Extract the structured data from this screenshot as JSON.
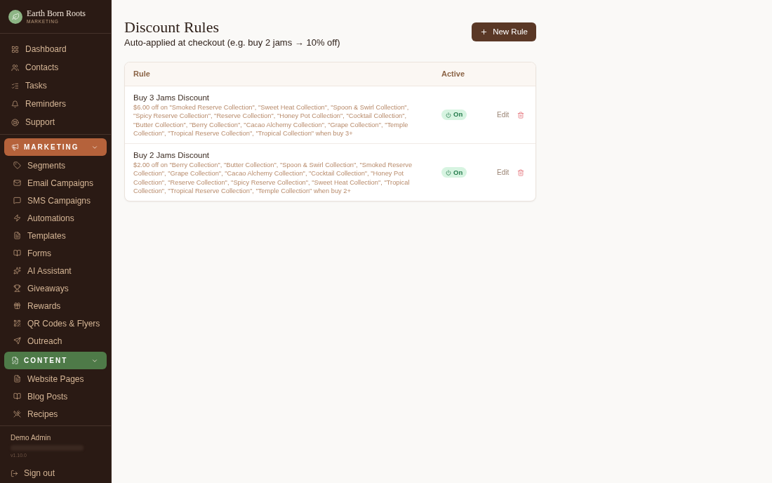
{
  "sidebar": {
    "brand": {
      "name": "Earth Born Roots",
      "subtitle": "MARKETING"
    },
    "items": [
      "Dashboard",
      "Contacts",
      "Tasks",
      "Reminders",
      "Support"
    ],
    "sections": [
      {
        "title": "MARKETING",
        "color": "#b5623b",
        "expanded": true,
        "items": [
          "Segments",
          "Email Campaigns",
          "SMS Campaigns",
          "Automations",
          "Templates",
          "Forms",
          "AI Assistant",
          "Giveaways",
          "Rewards",
          "QR Codes & Flyers",
          "Outreach"
        ]
      },
      {
        "title": "CONTENT",
        "color": "#4e7a48",
        "expanded": true,
        "items": [
          "Website Pages",
          "Blog Posts",
          "Recipes"
        ]
      }
    ],
    "user": {
      "name": "Demo Admin",
      "version": "v1.10.0"
    },
    "sign_out": "Sign out"
  },
  "page": {
    "title": "Discount Rules",
    "subtitle": "Auto-applied at checkout (e.g. buy 2 jams → 10% off)",
    "new_button": "New Rule"
  },
  "table": {
    "columns": [
      "Rule",
      "Active"
    ],
    "rows": [
      {
        "name": "Buy 3 Jams Discount",
        "description": "$6.00 off on \"Smoked Reserve Collection\", \"Sweet Heat Collection\", \"Spoon & Swirl Collection\", \"Spicy Reserve Collection\", \"Reserve Collection\", \"Honey Pot Collection\", \"Cocktail Collection\", \"Butter Collection\", \"Berry Collection\", \"Cacao Alchemy Collection\", \"Grape Collection\", \"Temple Collection\", \"Tropical Reserve Collection\", \"Tropical Collection\" when buy 3+",
        "active": true,
        "status": "On",
        "edit": "Edit"
      },
      {
        "name": "Buy 2 Jams Discount",
        "description": "$2.00 off on \"Berry Collection\", \"Butter Collection\", \"Spoon & Swirl Collection\", \"Smoked Reserve Collection\", \"Grape Collection\", \"Cacao Alchemy Collection\", \"Cocktail Collection\", \"Honey Pot Collection\", \"Reserve Collection\", \"Spicy Reserve Collection\", \"Sweet Heat Collection\", \"Tropical Collection\", \"Tropical Reserve Collection\", \"Temple Collection\" when buy 2+",
        "active": true,
        "status": "On",
        "edit": "Edit"
      }
    ]
  }
}
